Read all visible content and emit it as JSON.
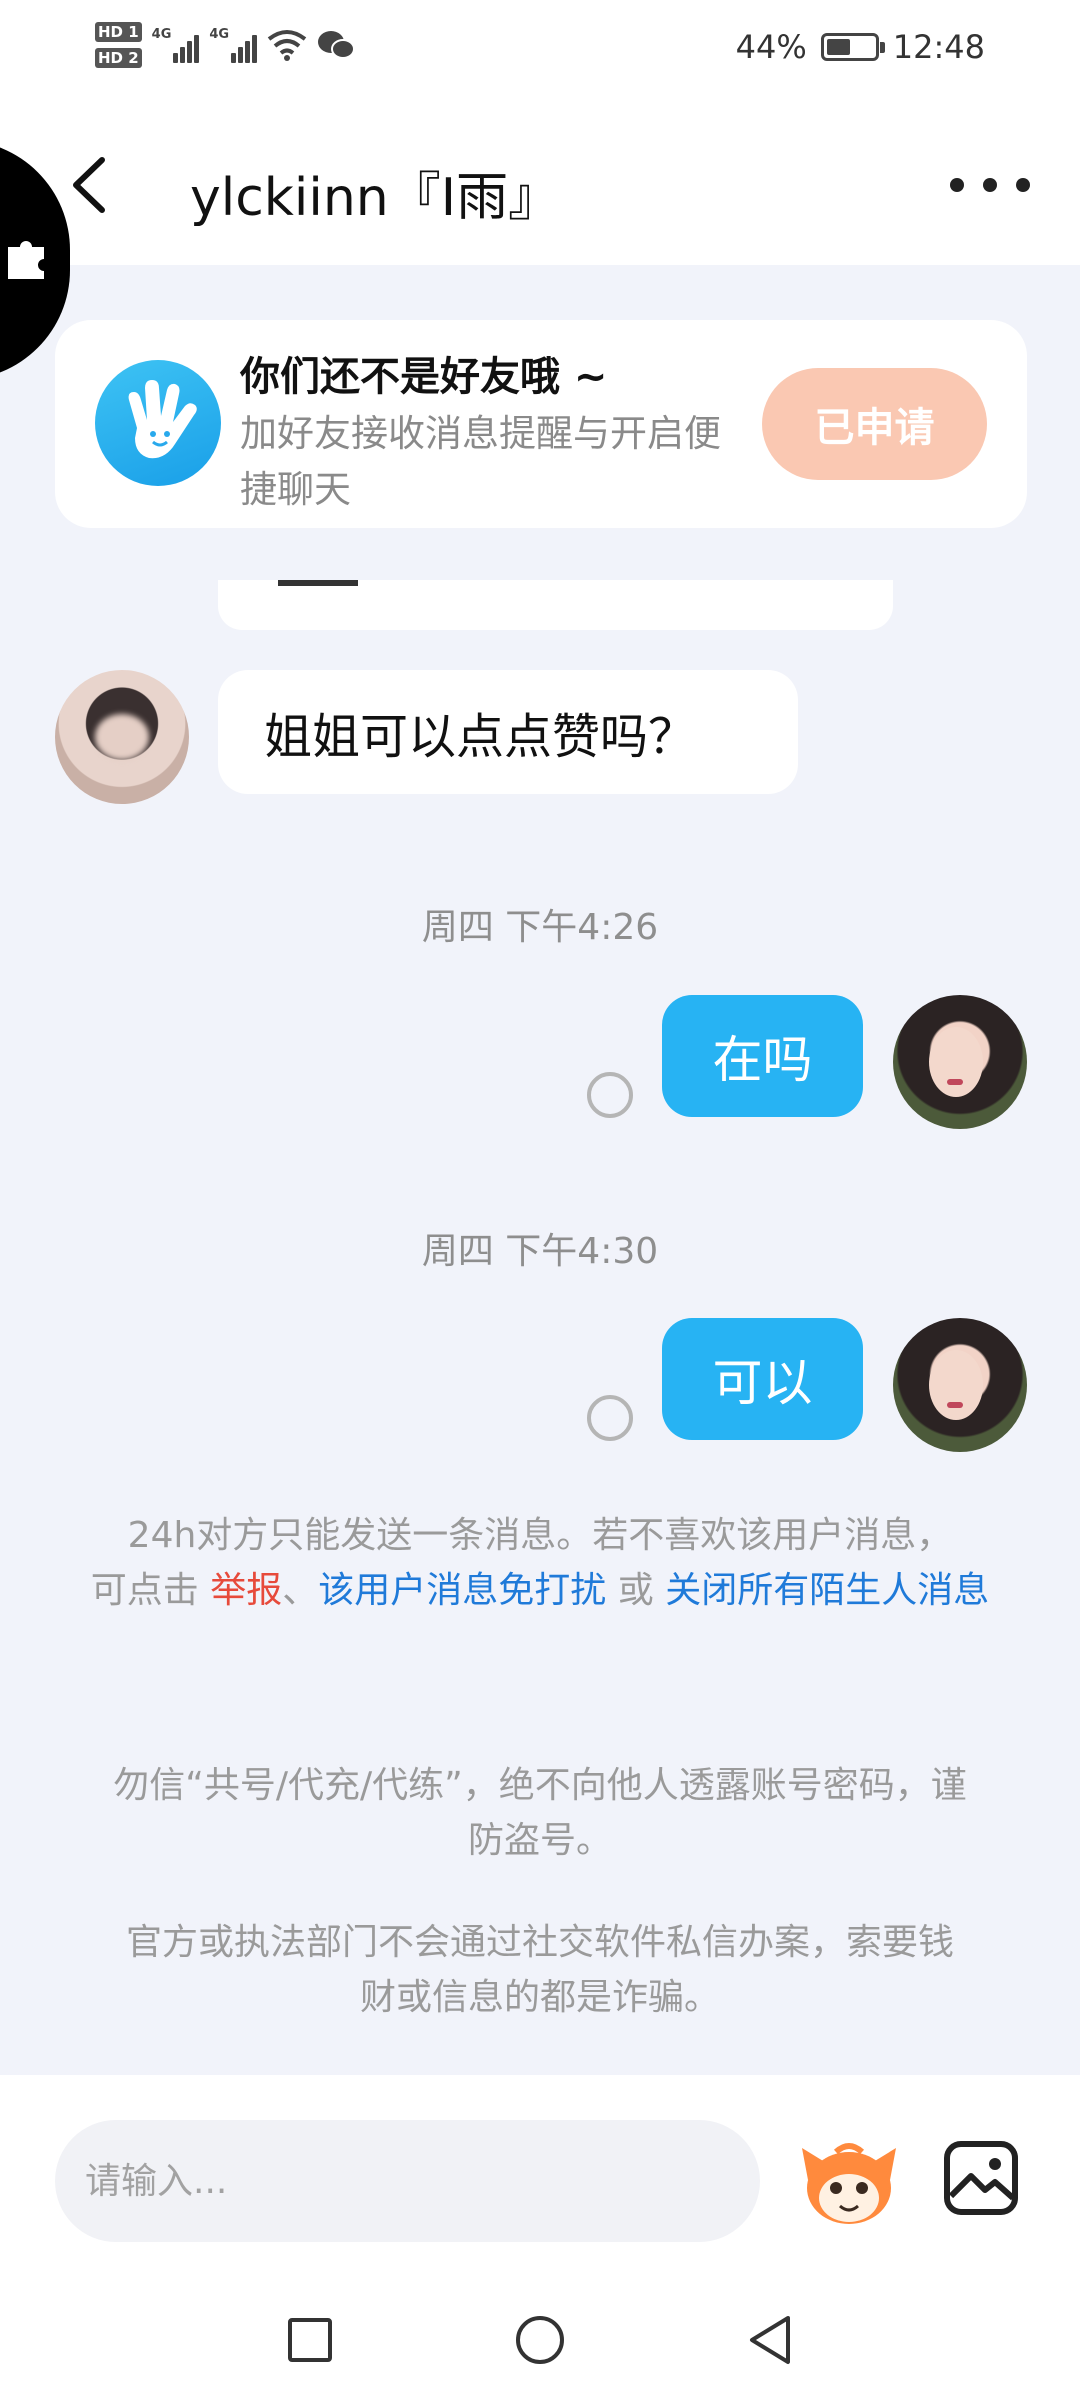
{
  "status_bar": {
    "hd1": "HD 1",
    "hd2": "HD 2",
    "net1": "4G",
    "net2": "4G",
    "battery_percent": "44%",
    "time": "12:48"
  },
  "header": {
    "title": "ylckiinn『I雨』"
  },
  "friend_banner": {
    "title": "你们还不是好友哦 ~",
    "description": "加好友接收消息提醒与开启便捷聊天",
    "button_label": "已申请"
  },
  "messages": {
    "peer_message": "姐姐可以点点赞吗？",
    "timestamp_1": "周四 下午4:26",
    "self_message_1": "在吗",
    "timestamp_2": "周四 下午4:30",
    "self_message_2": "可以"
  },
  "limit_notice": {
    "line1": "24h对方只能发送一条消息。若不喜欢该用户消息，",
    "prefix": "可点击 ",
    "report": "举报",
    "sep1": "、",
    "mute_user": "该用户消息免打扰",
    "sep2": " 或 ",
    "close_strangers": "关闭所有陌生人消息"
  },
  "safety_notices": {
    "notice1": "勿信“共号/代充/代练”，绝不向他人透露账号密码，谨防盗号。",
    "notice2": "官方或执法部门不会通过社交软件私信办案，索要钱财或信息的都是诈骗。"
  },
  "input_bar": {
    "placeholder": "请输入..."
  },
  "colors": {
    "accent_blue": "#27b3f3",
    "applied_button": "#fac8b2",
    "report_red": "#e74a3b",
    "link_blue": "#1f7ad9"
  },
  "icons": [
    "back-icon",
    "more-icon",
    "puzzle-icon",
    "wave-hand-icon",
    "emoji-mascot-icon",
    "image-icon",
    "square-nav-icon",
    "home-circle-icon",
    "back-triangle-icon"
  ]
}
